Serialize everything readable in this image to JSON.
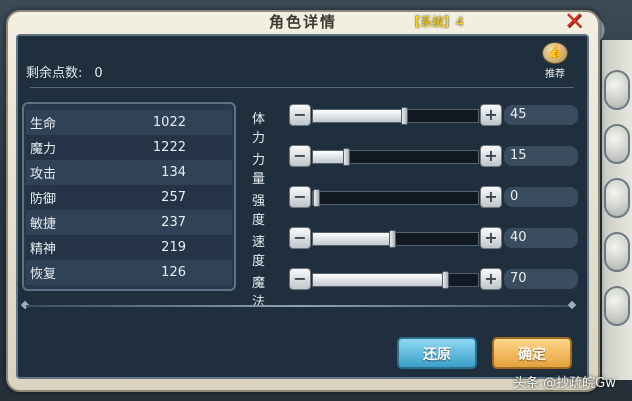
{
  "dialog": {
    "title": "角色详情",
    "system_tag": "【系统】4",
    "close_symbol": "✕"
  },
  "points": {
    "label": "剩余点数:",
    "value": "0"
  },
  "recommend": {
    "icon": "thumbs-up-icon",
    "label": "推荐"
  },
  "stats": [
    {
      "name": "生命",
      "value": "1022"
    },
    {
      "name": "魔力",
      "value": "1222"
    },
    {
      "name": "攻击",
      "value": "134"
    },
    {
      "name": "防御",
      "value": "257"
    },
    {
      "name": "敏捷",
      "value": "237"
    },
    {
      "name": "精神",
      "value": "219"
    },
    {
      "name": "恢复",
      "value": "126"
    }
  ],
  "sliders": [
    {
      "label": "体力",
      "value": "45",
      "fill_fraction": 0.55
    },
    {
      "label": "力量",
      "value": "15",
      "fill_fraction": 0.2
    },
    {
      "label": "强度",
      "value": "0",
      "fill_fraction": 0.0
    },
    {
      "label": "速度",
      "value": "40",
      "fill_fraction": 0.48
    },
    {
      "label": "魔法",
      "value": "70",
      "fill_fraction": 0.8
    }
  ],
  "buttons": {
    "minus_symbol": "−",
    "plus_symbol": "+",
    "reset": "还原",
    "confirm": "确定"
  },
  "watermark": "头条 @抄疏皖Gw",
  "colors": {
    "accent_reset": "#3a9fc8",
    "accent_confirm": "#e4a13a",
    "close": "#d53020",
    "system_tag": "#ffd400"
  }
}
